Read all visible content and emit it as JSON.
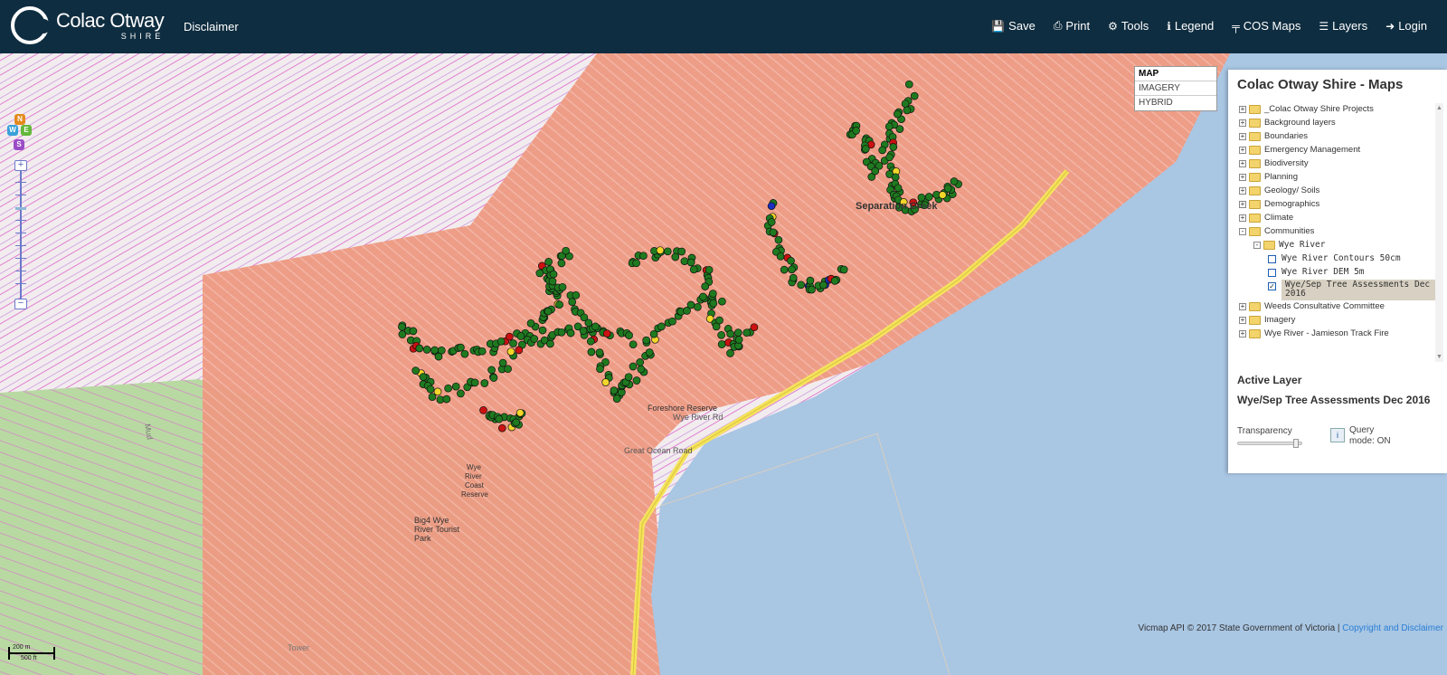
{
  "header": {
    "logo_title": "Colac Otway",
    "logo_subtitle": "SHIRE",
    "disclaimer": "Disclaimer",
    "nav": [
      {
        "label": "Save",
        "icon": "save-icon",
        "glyph": "💾"
      },
      {
        "label": "Print",
        "icon": "print-icon",
        "glyph": "⎙"
      },
      {
        "label": "Tools",
        "icon": "gear-icon",
        "glyph": "⚙"
      },
      {
        "label": "Legend",
        "icon": "info-icon",
        "glyph": "ℹ"
      },
      {
        "label": "COS Maps",
        "icon": "signpost-icon",
        "glyph": "╤"
      },
      {
        "label": "Layers",
        "icon": "list-icon",
        "glyph": "☰"
      },
      {
        "label": "Login",
        "icon": "login-icon",
        "glyph": "➜"
      }
    ]
  },
  "compass": {
    "n": "N",
    "w": "W",
    "e": "E",
    "s": "S"
  },
  "map_types": {
    "items": [
      "MAP",
      "IMAGERY",
      "HYBRID"
    ],
    "active": "MAP"
  },
  "map_labels": {
    "cumberland_creek": "Separation Creek",
    "foreshore": "Foreshore Reserve",
    "wye_river_road": "Wye River Rd",
    "great_ocean_road": "Great Ocean Road",
    "big4_1": "Big4 Wye",
    "big4_2": "River Tourist",
    "big4_3": "Park",
    "wye_1": "Wye",
    "wye_2": "River",
    "wye_3": "Coast",
    "wye_4": "Reserve",
    "mud": "Mud",
    "tower": "Tower"
  },
  "panel": {
    "title": "Colac Otway Shire - Maps",
    "tree": [
      {
        "label": "_Colac Otway Shire Projects",
        "type": "folder",
        "level": 0,
        "state": "+"
      },
      {
        "label": "Background layers",
        "type": "folder",
        "level": 0,
        "state": "+"
      },
      {
        "label": "Boundaries",
        "type": "folder",
        "level": 0,
        "state": "+"
      },
      {
        "label": "Emergency Management",
        "type": "folder",
        "level": 0,
        "state": "+"
      },
      {
        "label": "Biodiversity",
        "type": "folder",
        "level": 0,
        "state": "+"
      },
      {
        "label": "Planning",
        "type": "folder",
        "level": 0,
        "state": "+"
      },
      {
        "label": "Geology/ Soils",
        "type": "folder",
        "level": 0,
        "state": "+"
      },
      {
        "label": "Demographics",
        "type": "folder",
        "level": 0,
        "state": "+"
      },
      {
        "label": "Climate",
        "type": "folder",
        "level": 0,
        "state": "+"
      },
      {
        "label": "Communities",
        "type": "folder",
        "level": 0,
        "state": "-"
      },
      {
        "label": "Wye River",
        "type": "folder",
        "level": 1,
        "state": "-"
      },
      {
        "label": "Wye River Contours 50cm",
        "type": "layer",
        "level": 2,
        "checked": false
      },
      {
        "label": "Wye River DEM 5m",
        "type": "layer",
        "level": 2,
        "checked": false
      },
      {
        "label": "Wye/Sep Tree Assessments Dec 2016",
        "type": "layer",
        "level": 2,
        "checked": true,
        "selected": true
      },
      {
        "label": "Weeds Consultative Committee",
        "type": "folder",
        "level": 0,
        "state": "+"
      },
      {
        "label": "Imagery",
        "type": "folder",
        "level": 0,
        "state": "+"
      },
      {
        "label": "Wye River - Jamieson Track Fire",
        "type": "folder",
        "level": 0,
        "state": "+"
      }
    ],
    "active_layer_heading": "Active Layer",
    "active_layer_name": "Wye/Sep Tree Assessments Dec 2016",
    "transparency_label": "Transparency",
    "transparency_value": 0.92,
    "query_line1": "Query",
    "query_line2": "mode: ON"
  },
  "attribution": {
    "text": "Vicmap API © 2017 State Government of Victoria |",
    "link": "Copyright and Disclaimer"
  },
  "scale": {
    "top": "200 m",
    "bottom": "500 ft"
  },
  "colors": {
    "header_bg": "#0f2d40",
    "fire_overlay": "#ee9a82",
    "sea": "#a9c6e3",
    "tree_point": "#1f7a1f",
    "tree_point_red": "#cc1111",
    "tree_point_yellow": "#f3d62a",
    "tree_point_blue": "#1a2fc0"
  }
}
